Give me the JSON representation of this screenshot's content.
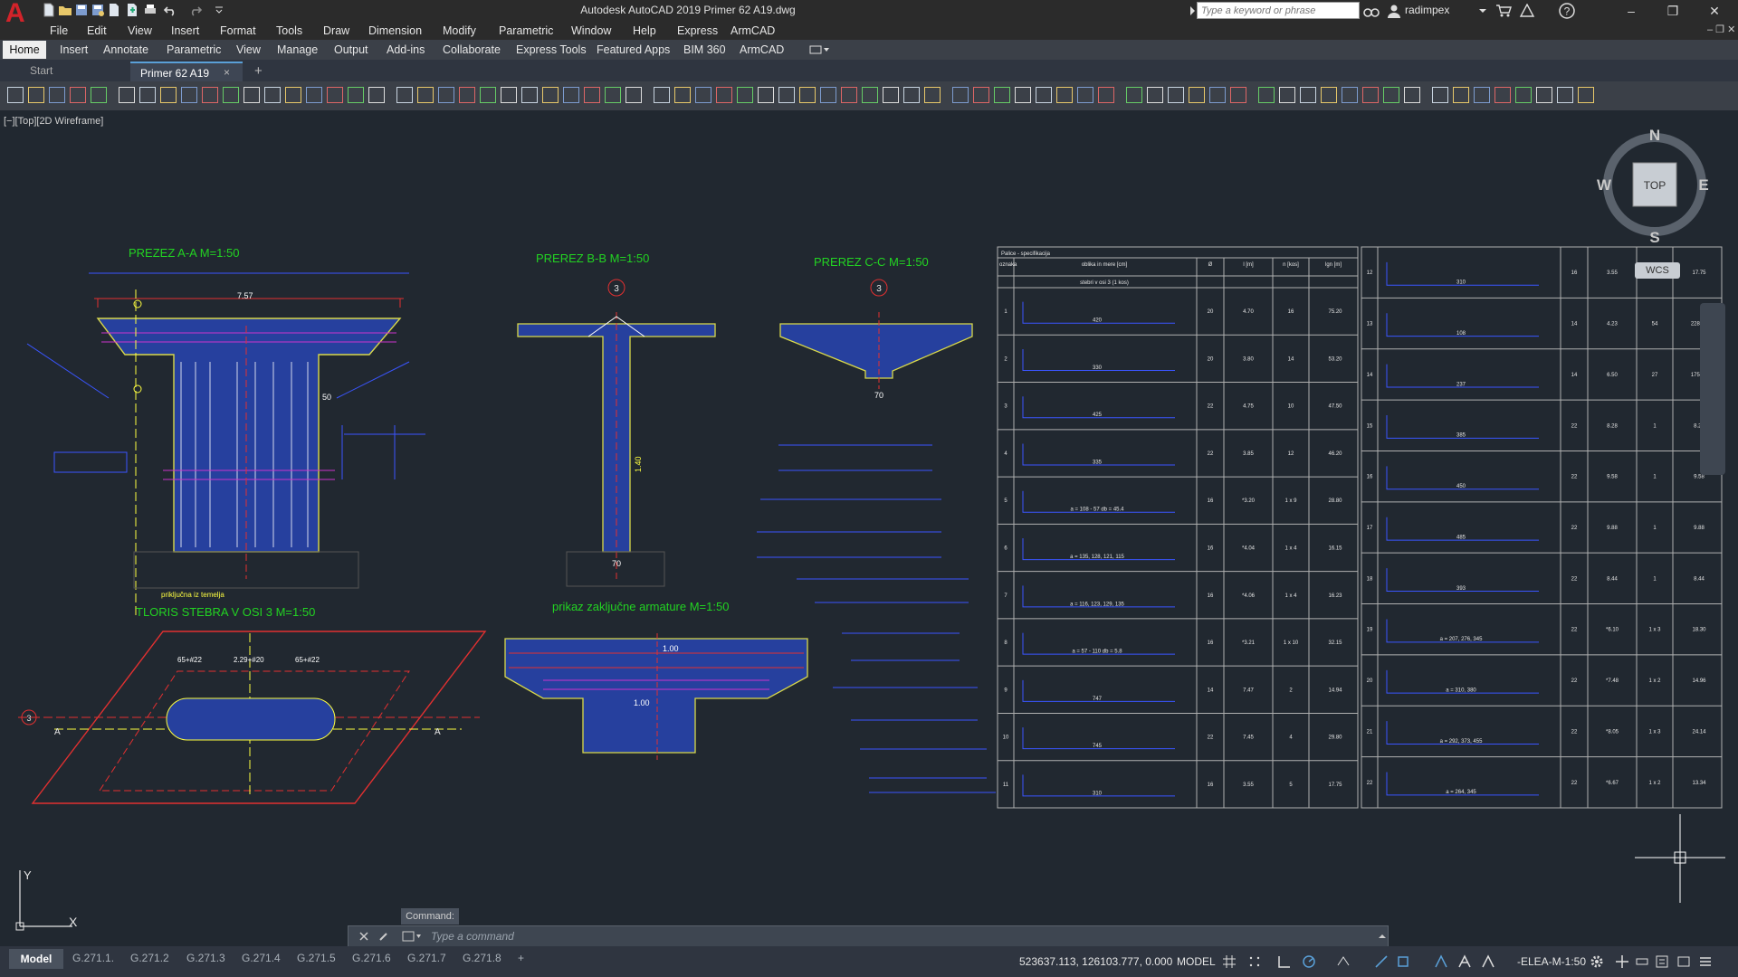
{
  "app": {
    "title": "Autodesk AutoCAD 2019    Primer 62 A19.dwg",
    "logo": "A",
    "search_placeholder": "Type a keyword or phrase",
    "user": "radimpex",
    "help": "?",
    "accent": "#d2232a"
  },
  "menu": [
    "File",
    "Edit",
    "View",
    "Insert",
    "Format",
    "Tools",
    "Draw",
    "Dimension",
    "Modify",
    "Parametric",
    "Window",
    "Help",
    "Express",
    "ArmCAD"
  ],
  "ribbon_tabs": [
    "Home",
    "Insert",
    "Annotate",
    "Parametric",
    "View",
    "Manage",
    "Output",
    "Add-ins",
    "Collaborate",
    "Express Tools",
    "Featured Apps",
    "BIM 360",
    "ArmCAD"
  ],
  "doc_tabs": {
    "start": "Start",
    "file": "Primer 62 A19",
    "close": "×",
    "add": "+"
  },
  "viewport": {
    "label": "[−][Top][2D Wireframe]"
  },
  "viewcube": {
    "n": "N",
    "s": "S",
    "e": "E",
    "w": "W",
    "top": "TOP",
    "wcs": "WCS"
  },
  "drawing": {
    "sec_aa": "PREZEZ  A-A  M=1:50",
    "sec_bb": "PREREZ B-B  M=1:50",
    "sec_cc": "PREREZ C-C  M=1:50",
    "plan": "TLORIS STEBRA  V OSI 3 M=1:50",
    "closing": "prikaz  zaključne armature   M=1:50",
    "axis3": "3",
    "dim_757": "7.57",
    "dim_50": "50",
    "dim_100": "1.00",
    "dim_70": "70",
    "dim_140": "1.40",
    "plan_a": "A",
    "plan_note": "priključna iz temelja",
    "plan_dims": [
      "65+#22",
      "2.29+#20",
      "65+#22"
    ],
    "table_title": "Palice - specifikacija",
    "table_heads": [
      "oznaka",
      "oblika in mere [cm]",
      "Ø",
      "l [m]",
      "n [kos]",
      "lgn [m]"
    ],
    "table_sub": "stebri v osi 3 (1 kos)",
    "rows_left": [
      {
        "n": "1",
        "d": "20",
        "l": "4.70",
        "k": "16",
        "t": "75.20",
        "m": "420"
      },
      {
        "n": "2",
        "d": "20",
        "l": "3.80",
        "k": "14",
        "t": "53.20",
        "m": "330"
      },
      {
        "n": "3",
        "d": "22",
        "l": "4.75",
        "k": "10",
        "t": "47.50",
        "m": "425"
      },
      {
        "n": "4",
        "d": "22",
        "l": "3.85",
        "k": "12",
        "t": "46.20",
        "m": "335"
      },
      {
        "n": "5",
        "d": "16",
        "l": "*3.20",
        "k": "1 x 9",
        "t": "28.80",
        "m": "a = 108 - 57 db = 45.4"
      },
      {
        "n": "6",
        "d": "16",
        "l": "*4.04",
        "k": "1 x 4",
        "t": "16.15",
        "m": "a = 135, 128, 121, 115"
      },
      {
        "n": "7",
        "d": "16",
        "l": "*4.06",
        "k": "1 x 4",
        "t": "16.23",
        "m": "a = 116, 123, 129, 135"
      },
      {
        "n": "8",
        "d": "16",
        "l": "*3.21",
        "k": "1 x 10",
        "t": "32.15",
        "m": "a = 57 - 110 db = 5.8"
      },
      {
        "n": "9",
        "d": "14",
        "l": "7.47",
        "k": "2",
        "t": "14.94",
        "m": "747"
      },
      {
        "n": "10",
        "d": "22",
        "l": "7.45",
        "k": "4",
        "t": "29.80",
        "m": "745"
      },
      {
        "n": "11",
        "d": "16",
        "l": "3.55",
        "k": "5",
        "t": "17.75",
        "m": "310"
      }
    ],
    "rows_right": [
      {
        "n": "12",
        "d": "16",
        "l": "3.55",
        "k": "5",
        "t": "17.75",
        "m": "310"
      },
      {
        "n": "13",
        "d": "14",
        "l": "4.23",
        "k": "54",
        "t": "228.42",
        "m": "108"
      },
      {
        "n": "14",
        "d": "14",
        "l": "6.50",
        "k": "27",
        "t": "175.50",
        "m": "237"
      },
      {
        "n": "15",
        "d": "22",
        "l": "8.28",
        "k": "1",
        "t": "8.28",
        "m": "385"
      },
      {
        "n": "16",
        "d": "22",
        "l": "9.58",
        "k": "1",
        "t": "9.58",
        "m": "450"
      },
      {
        "n": "17",
        "d": "22",
        "l": "9.88",
        "k": "1",
        "t": "9.88",
        "m": "485"
      },
      {
        "n": "18",
        "d": "22",
        "l": "8.44",
        "k": "1",
        "t": "8.44",
        "m": "393"
      },
      {
        "n": "19",
        "d": "22",
        "l": "*6.10",
        "k": "1 x 3",
        "t": "18.30",
        "m": "a = 207, 276, 345"
      },
      {
        "n": "20",
        "d": "22",
        "l": "*7.48",
        "k": "1 x 2",
        "t": "14.96",
        "m": "a = 310, 380"
      },
      {
        "n": "21",
        "d": "22",
        "l": "*8.05",
        "k": "1 x 3",
        "t": "24.14",
        "m": "a = 292, 373, 455"
      },
      {
        "n": "22",
        "d": "22",
        "l": "*6.67",
        "k": "1 x 2",
        "t": "13.34",
        "m": "a = 264, 345"
      }
    ]
  },
  "command": {
    "history": "Command:",
    "placeholder": "Type  a  command"
  },
  "layouts": [
    "Model",
    "G.271.1.",
    "G.271.2",
    "G.271.3",
    "G.271.4",
    "G.271.5",
    "G.271.6",
    "G.271.7",
    "G.271.8",
    "+"
  ],
  "status": {
    "coords": "523637.113, 126103.777, 0.000",
    "space": "MODEL",
    "scale": "-ELEA-M-1:50"
  }
}
